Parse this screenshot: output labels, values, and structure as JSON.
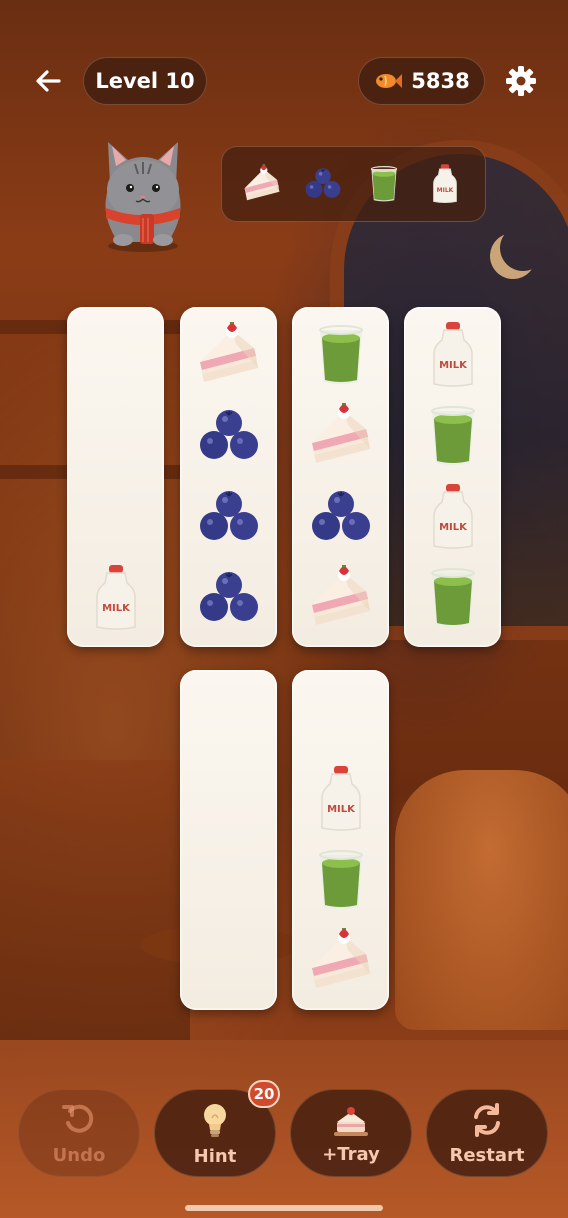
{
  "header": {
    "level_label": "Level 10",
    "coins": "5838",
    "back_icon": "back-arrow-icon",
    "coin_icon": "fish-icon",
    "settings_icon": "gear-icon"
  },
  "order": {
    "items": [
      "cake",
      "blueberries",
      "matcha",
      "milk"
    ]
  },
  "columns": [
    {
      "name": "column-1",
      "items": [
        "milk"
      ]
    },
    {
      "name": "column-2",
      "items": [
        "cake",
        "blueberries",
        "blueberries",
        "blueberries"
      ]
    },
    {
      "name": "column-3",
      "items": [
        "matcha",
        "cake",
        "blueberries",
        "cake"
      ]
    },
    {
      "name": "column-4",
      "items": [
        "milk",
        "matcha",
        "milk",
        "matcha"
      ]
    },
    {
      "name": "column-5",
      "items": []
    },
    {
      "name": "column-6",
      "items": [
        "milk",
        "matcha",
        "cake"
      ]
    }
  ],
  "item_labels": {
    "milk_bottle_text": "MILK"
  },
  "controls": {
    "undo_label": "Undo",
    "hint_label": "Hint",
    "hint_count": "20",
    "tray_label": "+Tray",
    "restart_label": "Restart"
  },
  "colors": {
    "panel": "#4e2412",
    "column": "#f8f3ea",
    "badge": "#d24a2c",
    "button_text": "#f6c8b0"
  }
}
